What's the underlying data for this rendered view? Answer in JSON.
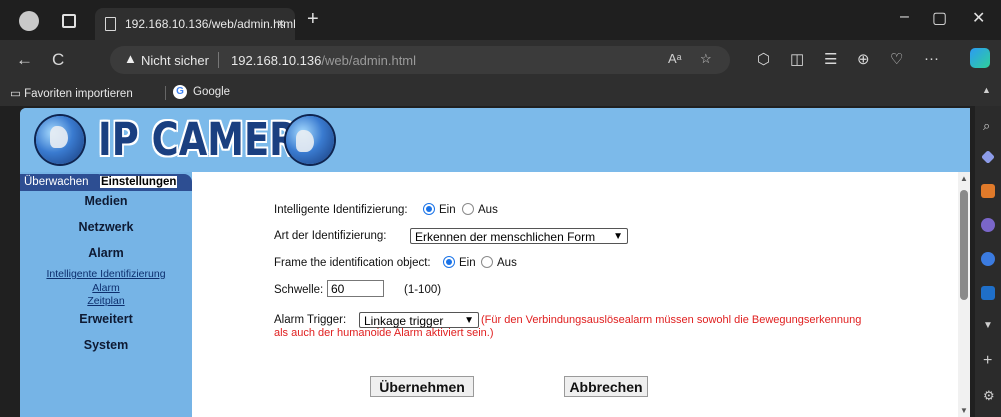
{
  "browser": {
    "tab_title": "192.168.10.136/web/admin.html",
    "tab_close": "×",
    "new_tab": "+",
    "minimize": "–",
    "maximize": "▢",
    "close": "✕",
    "back": "←",
    "reload": "C",
    "security_label": "Nicht sicher",
    "url_host": "192.168.10.136",
    "url_path": "/web/admin.html",
    "more": "···"
  },
  "favorites": {
    "import_label": "Favoriten importieren",
    "google_label": "Google"
  },
  "banner": {
    "logo_text": "IP CAMERA"
  },
  "sidebar": {
    "tab_ueberwachen": "Überwachen",
    "tab_einstellungen": "Einstellungen",
    "menu_medien": "Medien",
    "menu_netzwerk": "Netzwerk",
    "menu_alarm": "Alarm",
    "link_intelligente": "Intelligente Identifizierung",
    "link_alarm": "Alarm",
    "link_zeitplan": "Zeitplan",
    "menu_erweitert": "Erweitert",
    "menu_system": "System"
  },
  "form": {
    "intelligente_label": "Intelligente Identifizierung:",
    "ein": "Ein",
    "aus": "Aus",
    "art_label": "Art der Identifizierung:",
    "art_value": "Erkennen der menschlichen Form",
    "frame_label": "Frame the identification object:",
    "schwelle_label": "Schwelle:",
    "schwelle_value": "60",
    "schwelle_range": "(1-100)",
    "trigger_label": "Alarm Trigger:",
    "trigger_value": "Linkage trigger",
    "trigger_note_1": "(Für den Verbindungsauslösealarm müssen sowohl die Bewegungserkennung",
    "trigger_note_2": "als auch der humanoide Alarm aktiviert sein.)",
    "apply_label": "Übernehmen",
    "cancel_label": "Abbrechen"
  },
  "state": {
    "intelligente": "Ein",
    "frame": "Ein"
  }
}
